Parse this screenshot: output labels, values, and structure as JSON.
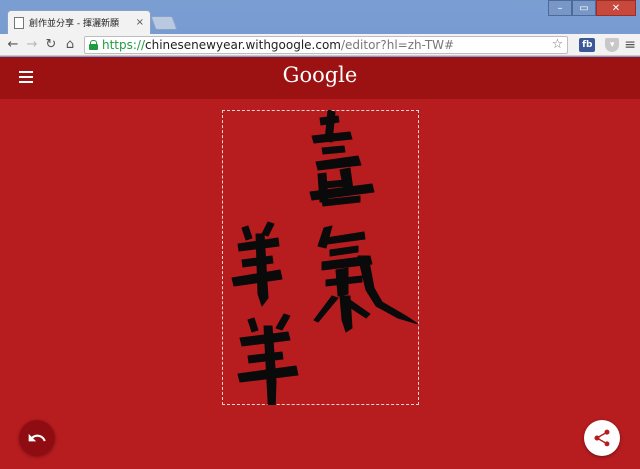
{
  "browser": {
    "tab": {
      "title": "創作並分享 - 揮灑新願",
      "close_glyph": "×"
    },
    "window_controls": {
      "minimize": "–",
      "maximize": "▭",
      "close": "✕"
    },
    "nav": {
      "back": "←",
      "forward": "→",
      "reload": "↻",
      "home": "⌂"
    },
    "address": {
      "scheme": "https://",
      "host": "chinesenewyear.withgoogle.com",
      "path": "/editor?hl=zh-TW#"
    },
    "extensions": {
      "bookmark_star": "☆",
      "fb_label": "fb",
      "shield_label": "▾",
      "menu_glyph": "≡"
    }
  },
  "app": {
    "brand": "Google",
    "colors": {
      "page_bg": "#b71c1f",
      "appbar_bg": "#9c1212",
      "ink": "#0a0a0a",
      "undo_bg": "#8f0d12"
    },
    "calligraphy_text": [
      "喜",
      "氣",
      "羊",
      "羊"
    ],
    "icons": {
      "menu": "hamburger-icon",
      "undo": "undo-icon",
      "share": "share-icon"
    }
  }
}
